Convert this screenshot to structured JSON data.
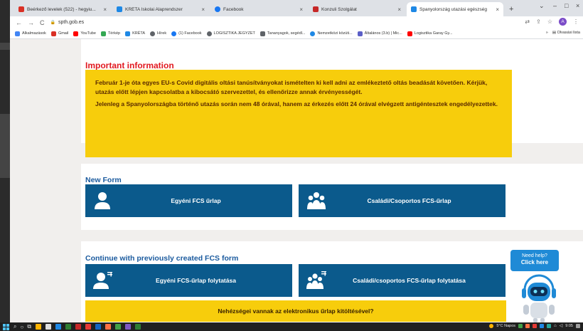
{
  "browser": {
    "tabs": [
      {
        "title": "Beérkező levelek (522) - hegyiu...",
        "favicon_color": "#d93025",
        "active": false
      },
      {
        "title": "KRÉTA Iskolai Alaprendszer",
        "favicon_color": "#1e88e5",
        "active": false
      },
      {
        "title": "Facebook",
        "favicon_color": "#1877f2",
        "active": false
      },
      {
        "title": "Konzuli Szolgálat",
        "favicon_color": "#c62828",
        "active": false
      },
      {
        "title": "Spanyolország utazási egészség",
        "favicon_color": "#1e88e5",
        "active": true
      }
    ],
    "new_tab_label": "+",
    "address": {
      "url": "spth.gob.es",
      "back": "←",
      "forward": "→",
      "reload": "C",
      "lock": "🔒",
      "profile_initial": "A"
    },
    "bookmarks": [
      {
        "label": "Alkalmazások",
        "color": "#4285f4"
      },
      {
        "label": "Gmail",
        "color": "#d93025"
      },
      {
        "label": "YouTube",
        "color": "#ff0000"
      },
      {
        "label": "Térkép",
        "color": "#34a853"
      },
      {
        "label": "KRÉTA",
        "color": "#1e88e5"
      },
      {
        "label": "Hírek",
        "color": "#5f6368"
      },
      {
        "label": "(1) Facebook",
        "color": "#1877f2"
      },
      {
        "label": "LOGISZTIKA JEGYZET",
        "color": "#5f6368"
      },
      {
        "label": "Tananyagok, segédl...",
        "color": "#5f6368"
      },
      {
        "label": "Nemzetközi közúti...",
        "color": "#1e88e5"
      },
      {
        "label": "Általános (3.b) | Mic...",
        "color": "#5b5fc7"
      },
      {
        "label": "Logisztika Garay Gy...",
        "color": "#ff0000"
      }
    ],
    "bookmarks_more": "»",
    "reading_list": "Olvasási lista"
  },
  "page": {
    "important": {
      "title": "Important information",
      "p1": "Február 1-je óta egyes EU-s Covid digitális oltási tanúsítványokat ismételten ki kell adni az emlékeztető oltás beadását követően. Kérjük, utazás előtt lépjen kapcsolatba a kibocsátó szervezettel, és ellenőrizze annak érvényességét.",
      "p2": "Jelenleg a Spanyolországba történő utazás során nem 48 órával, hanem az érkezés előtt 24 órával elvégzett antigéntesztek engedélyezettek."
    },
    "new_form": {
      "title": "New Form",
      "individual_label": "Egyéni FCS űrlap",
      "group_label": "Családi/Csoportos FCS-űrlap"
    },
    "continue_form": {
      "title": "Continue with previously created FCS form",
      "individual_label": "Egyéni FCS-űrlap folytatása",
      "group_label": "Családi/csoportos FCS-űrlap folytatása"
    },
    "difficulty_label": "Nehézségei vannak az elektronikus űrlap kitöltésével?",
    "help": {
      "line1": "Need help?",
      "line2": "Click here"
    }
  },
  "taskbar": {
    "weather": "5°C Napos",
    "time": "9:05",
    "app_colors": [
      "#4fc3f7",
      "#ffb300",
      "#e0e0e0",
      "#1e88e5",
      "#2e7d32",
      "#c62828",
      "#e53935",
      "#1565c0",
      "#ff7043",
      "#43a047",
      "#7e57c2",
      "#2e7d32"
    ]
  }
}
